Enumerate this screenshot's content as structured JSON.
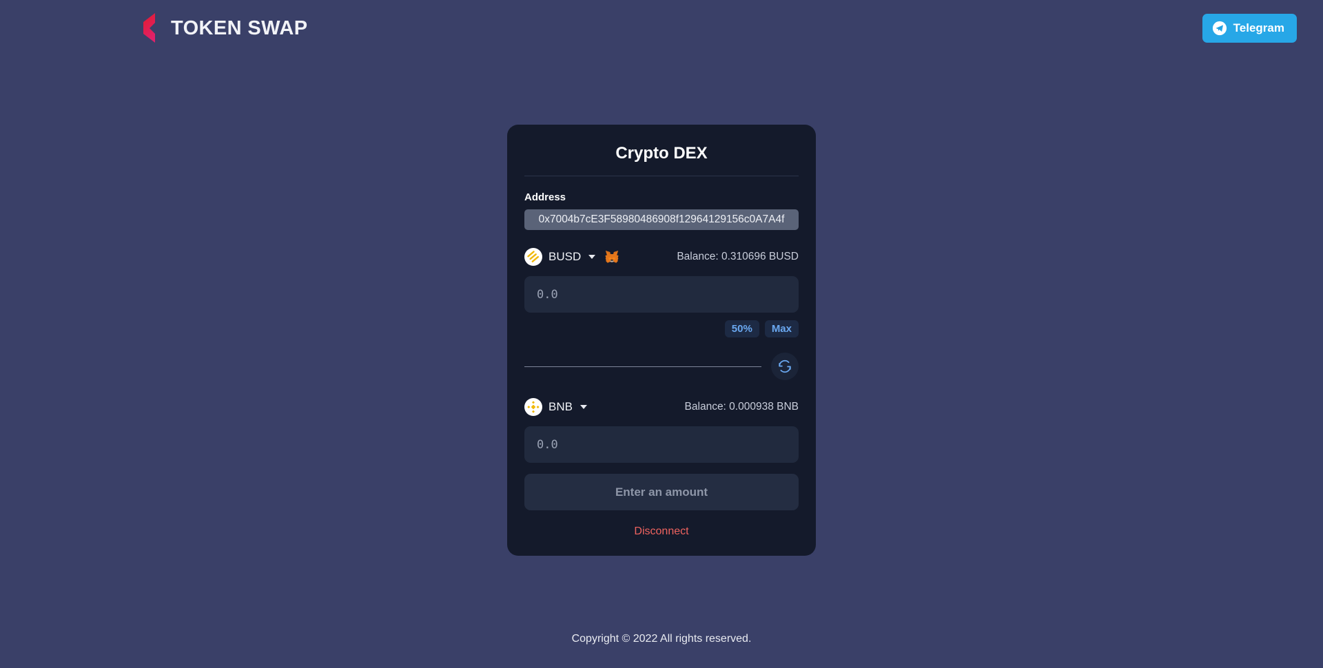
{
  "header": {
    "brand_name": "TOKEN SWAP",
    "brand_icon": "token-swap-logo-icon",
    "telegram": {
      "label": "Telegram",
      "icon": "telegram-paper-plane-icon",
      "color": "#27a7e7"
    }
  },
  "card": {
    "title": "Crypto DEX",
    "address_label": "Address",
    "address_value": "0x7004b7cE3F58980486908f12964129156c0A7A4f",
    "from": {
      "token_symbol": "BUSD",
      "token_icon": "busd-token-icon",
      "wallet_icon": "metamask-fox-icon",
      "caret_icon": "chevron-down-icon",
      "balance": "Balance: 0.310696 BUSD",
      "amount_value": "",
      "amount_placeholder": "0.0",
      "quick": [
        {
          "label": "50%"
        },
        {
          "label": "Max"
        }
      ]
    },
    "swap": {
      "icon": "swap-arrows-icon"
    },
    "to": {
      "token_symbol": "BNB",
      "token_icon": "bnb-token-icon",
      "caret_icon": "chevron-down-icon",
      "balance": "Balance: 0.000938 BNB",
      "amount_value": "",
      "amount_placeholder": "0.0"
    },
    "action_label": "Enter an amount",
    "disconnect_label": "Disconnect"
  },
  "footer": {
    "copyright": "Copyright © 2022 All rights reserved."
  },
  "colors": {
    "page_background": "#3a4068",
    "card_background": "#141a2b",
    "accent_blue": "#6aa8f0",
    "telegram_blue": "#27a7e7",
    "danger_red": "#f0635f",
    "logo_red": "#e0213f"
  }
}
